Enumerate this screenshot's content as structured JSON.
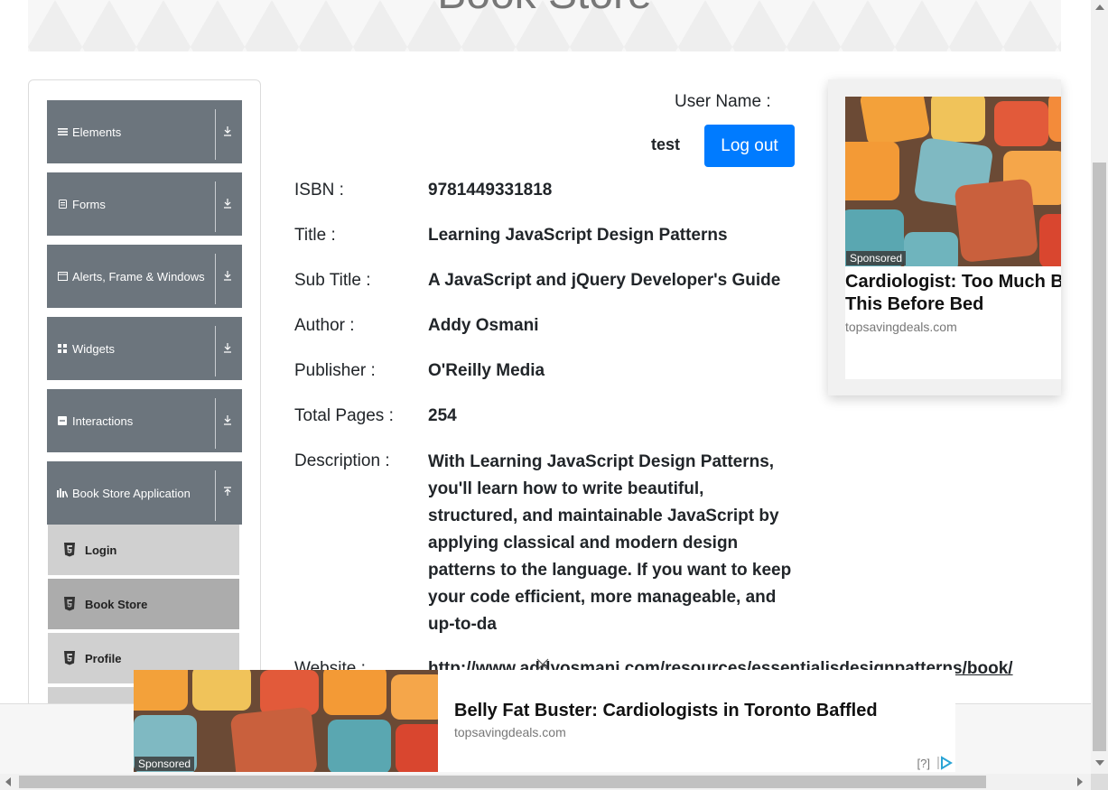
{
  "header": {
    "title": "Book Store"
  },
  "sidebar": {
    "groups": [
      {
        "label": "Elements",
        "icon": "hamburger-icon"
      },
      {
        "label": "Forms",
        "icon": "form-icon"
      },
      {
        "label": "Alerts, Frame & Windows",
        "icon": "window-icon"
      },
      {
        "label": "Widgets",
        "icon": "grid-icon"
      },
      {
        "label": "Interactions",
        "icon": "interaction-icon"
      },
      {
        "label": "Book Store Application",
        "icon": "bookshelf-icon",
        "expanded": true
      }
    ],
    "sub_items": [
      {
        "label": "Login",
        "icon": "html5-icon"
      },
      {
        "label": "Book Store",
        "icon": "html5-icon",
        "active": true
      },
      {
        "label": "Profile",
        "icon": "html5-icon"
      }
    ]
  },
  "user": {
    "label": "User Name :",
    "value": "test",
    "logout_label": "Log out"
  },
  "book": {
    "isbn_label": "ISBN :",
    "isbn": "9781449331818",
    "title_label": "Title :",
    "title": "Learning JavaScript Design Patterns",
    "subtitle_label": "Sub Title :",
    "subtitle": "A JavaScript and jQuery Developer's Guide",
    "author_label": "Author :",
    "author": "Addy Osmani",
    "publisher_label": "Publisher :",
    "publisher": "O'Reilly Media",
    "pages_label": "Total Pages :",
    "pages": "254",
    "description_label": "Description :",
    "description": "With Learning JavaScript Design Patterns, you'll learn how to write beautiful, structured, and maintainable JavaScript by applying classical and modern design patterns to the language. If you want to keep your code efficient, more manageable, and up-to-da",
    "website_label": "Website :",
    "website": "http://www.addyosmani.com/resources/essentialjsdesignpatterns/book/"
  },
  "side_ad": {
    "sponsored": "Sponsored",
    "title_line1": "Cardiologist: Too Much Belly",
    "title_line2": "This Before Bed",
    "domain": "topsavingdeals.com"
  },
  "bottom_ad": {
    "sponsored": "Sponsored",
    "title": "Belly Fat Buster: Cardiologists in Toronto Baffled",
    "domain": "topsavingdeals.com",
    "help": "[?]"
  },
  "colors": {
    "primary": "#007bff",
    "sidebar_header": "#6c757d",
    "sub_item": "#d0d0d0",
    "sub_item_active": "#acacac"
  }
}
